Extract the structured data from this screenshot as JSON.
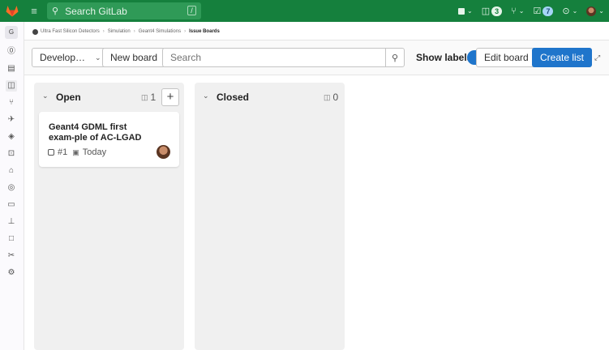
{
  "topbar": {
    "search_placeholder": "Search GitLab",
    "search_shortcut": "/",
    "issues_count": "3",
    "todo_count": "7"
  },
  "breadcrumb": {
    "items": [
      "Ultra Fast Silicon Detectors",
      "Simulation",
      "Geant4 Simulations",
      "Issue Boards"
    ]
  },
  "filterbar": {
    "board_selector": "Develop…",
    "new_board": "New board",
    "search_placeholder": "Search",
    "show_labels": "Show labels",
    "edit_board": "Edit board",
    "create_list": "Create list"
  },
  "lists": [
    {
      "title": "Open",
      "count": "1",
      "cards": [
        {
          "title": "Geant4 GDML first exam-ple of AC-LGAD",
          "ref": "#1",
          "due": "Today"
        }
      ]
    },
    {
      "title": "Closed",
      "count": "0",
      "cards": []
    }
  ],
  "colors": {
    "topbar": "#15803d",
    "primary": "#1f75cb",
    "board_bg": "#f0f0f0"
  }
}
